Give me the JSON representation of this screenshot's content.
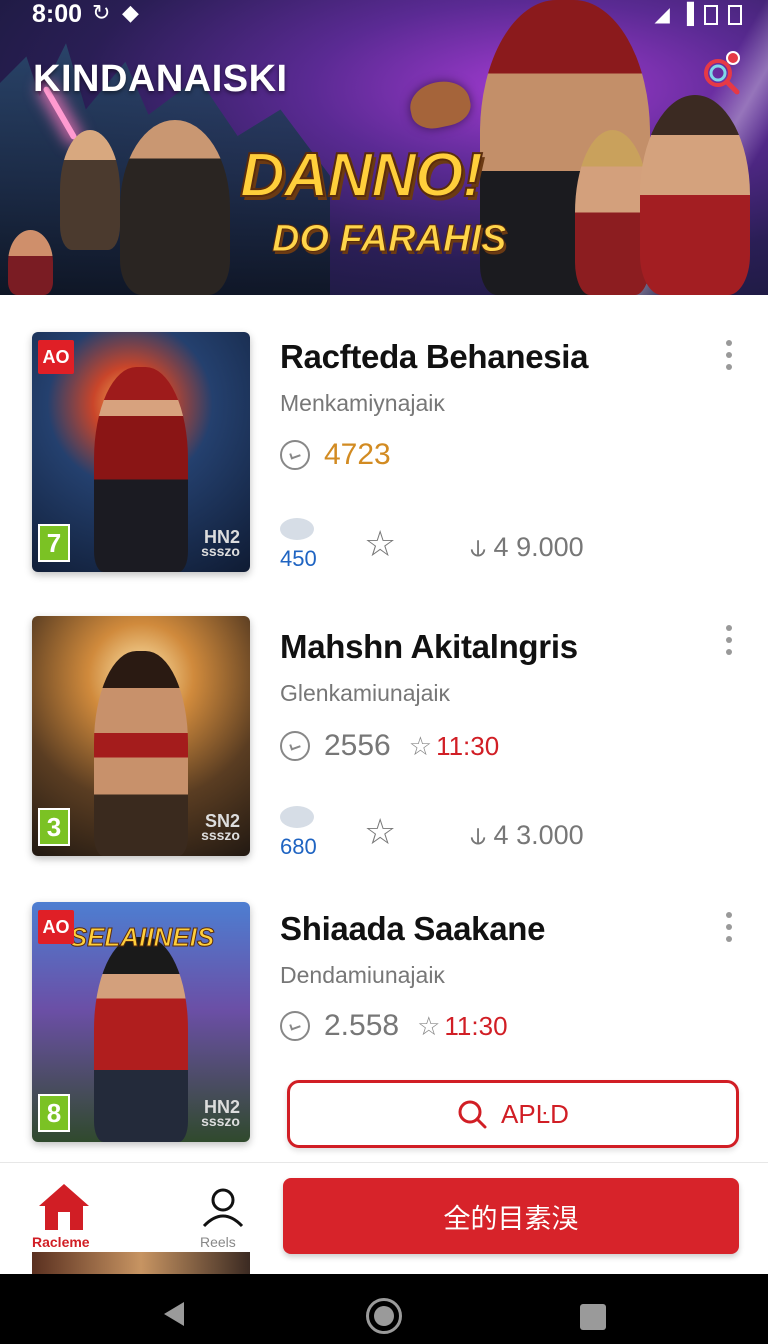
{
  "status_bar": {
    "time": "8:00",
    "sync_icon": "sync-icon",
    "wifi_icon": "wifi-icon"
  },
  "app": {
    "title": "KINDANAISKI"
  },
  "hero": {
    "logo_line1": "DANNO!",
    "logo_line2": "DO FARAHIS"
  },
  "cards": [
    {
      "title": "Racfteda Behanesia",
      "subtitle": "Menkamiynajaiĸ",
      "score": "4723",
      "comments": "450",
      "views": "4 9.000",
      "badge_top": "AO",
      "badge_num": "7",
      "code_big": "HN2",
      "code_small": "ssszo"
    },
    {
      "title": "Mahshn Akitalngris",
      "subtitle": "Glenkamiunajaiĸ",
      "score": "2556",
      "time": "11:30",
      "comments": "680",
      "views": "4 3.000",
      "badge_num": "3",
      "code_big": "SN2",
      "code_small": "ssszo"
    },
    {
      "title": "Shiaada Saakane",
      "subtitle": "Dendamiunajaiĸ",
      "score": "2.558",
      "time": "11:30",
      "badge_top": "AO",
      "badge_num": "8",
      "thumb_title": "SELAIINEIS",
      "code_big": "HN2",
      "code_small": "ssszo"
    }
  ],
  "actions": {
    "app_button": "APĿD",
    "primary_button": "全的目素湨"
  },
  "bottom_nav": {
    "home_label": "Racleme",
    "profile_label": "Reels"
  },
  "colors": {
    "accent": "#d7232a",
    "gold": "#d28b22",
    "link_blue": "#1f64c2"
  }
}
